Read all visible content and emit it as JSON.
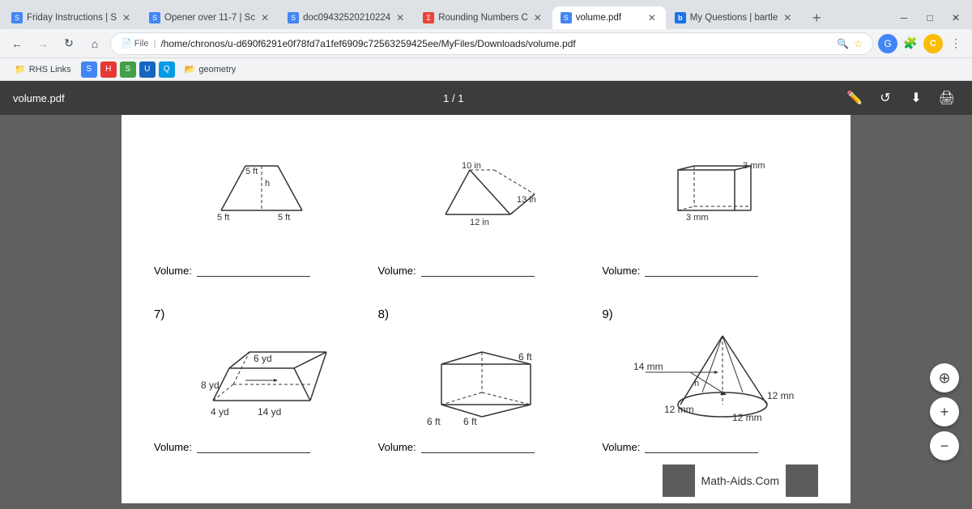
{
  "browser": {
    "tabs": [
      {
        "id": "tab1",
        "favicon_color": "#4285f4",
        "title": "Friday Instructions | S",
        "active": false,
        "favicon_letter": "S"
      },
      {
        "id": "tab2",
        "favicon_color": "#4285f4",
        "title": "Opener over 11-7 | Sc",
        "active": false,
        "favicon_letter": "S"
      },
      {
        "id": "tab3",
        "favicon_color": "#4285f4",
        "title": "doc09432520210224",
        "active": false,
        "favicon_letter": "S"
      },
      {
        "id": "tab4",
        "favicon_color": "#ea4335",
        "title": "Rounding Numbers C",
        "active": false,
        "favicon_letter": "Σ"
      },
      {
        "id": "tab5",
        "favicon_color": "#4285f4",
        "title": "volume.pdf",
        "active": true,
        "favicon_letter": "S"
      },
      {
        "id": "tab6",
        "favicon_color": "#1a73e8",
        "title": "My Questions | bartle",
        "active": false,
        "favicon_letter": "b"
      }
    ],
    "address": "/home/chronos/u-d690f6291e0f78fd7a1fef6909c72563259425ee/MyFiles/Downloads/volume.pdf",
    "address_prefix": "File",
    "bookmarks": [
      "RHS Links",
      "geometry"
    ],
    "back_enabled": true,
    "forward_enabled": false
  },
  "pdf": {
    "title": "volume.pdf",
    "page_indicator": "1 / 1",
    "page": {
      "top_problems": [
        {
          "label": "",
          "dims": {
            "h": "h",
            "side1": "5 ft",
            "side2": "5 ft",
            "label2": "5 ft"
          },
          "volume_label": "Volume:"
        },
        {
          "label": "",
          "dims": {
            "top": "10 in",
            "side1": "13 in",
            "bottom": "12 in"
          },
          "volume_label": "Volume:"
        },
        {
          "label": "",
          "dims": {
            "side1": "3 mm",
            "side2": "3 mm"
          },
          "volume_label": "Volume:"
        }
      ],
      "problems": [
        {
          "number": "7)",
          "dims": {
            "top": "6 yd",
            "left": "8 yd",
            "bottom_left": "4 yd",
            "bottom_right": "14 yd"
          },
          "volume_label": "Volume:"
        },
        {
          "number": "8)",
          "dims": {
            "top": "6 ft",
            "bottom_left": "6 ft",
            "bottom_right": "6 ft"
          },
          "volume_label": "Volume:"
        },
        {
          "number": "9)",
          "dims": {
            "top": "14 mm",
            "h": "h",
            "bottom_left": "12 mm",
            "bottom_right": "12 mm",
            "label_right": "12 mn"
          },
          "volume_label": "Volume:"
        }
      ]
    }
  },
  "zoom_buttons": {
    "expand": "⊕",
    "zoom_in": "+",
    "zoom_out": "−"
  },
  "watermark": "Math-Aids.Com"
}
